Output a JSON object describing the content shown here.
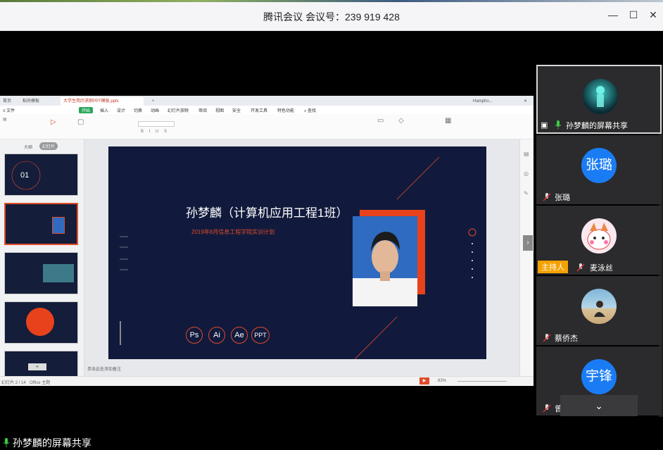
{
  "window": {
    "title": "腾讯会议  会议号：239 919 428"
  },
  "shared_screen": {
    "tabs": [
      "首页",
      "稻壳模板",
      "大学生简历求职PPT模板.pptx"
    ],
    "account": "Hampho...",
    "menus": [
      "开始",
      "插入",
      "设计",
      "切换",
      "动画",
      "幻灯片放映",
      "审阅",
      "视图",
      "安全",
      "开发工具",
      "特色功能",
      "查找"
    ],
    "active_menu": "开始",
    "thumbs_label": "大纲",
    "thumbs_tab": "幻灯片",
    "slide": {
      "title": "孙梦麟（计算机应用工程1班）",
      "subtitle": "2019年8月信息工程学院实训计划",
      "cover_num": "01",
      "software": [
        "Ps",
        "Ai",
        "Ae",
        "PPT"
      ]
    },
    "notes_hint": "单击此处添加备注",
    "status": {
      "slide_counter": "幻灯片 2 / 14",
      "theme": "Office 主题",
      "zoom": "83%"
    }
  },
  "participants": [
    {
      "name": "孙梦麟的屏幕共享",
      "avatar": "robot-avatar",
      "selected": true,
      "sharing": true
    },
    {
      "name": "张璐",
      "avatar_text": "张璐",
      "avatar_color": "#1a7cf5"
    },
    {
      "name": "麦泳丝",
      "avatar": "cartoon-avatar",
      "host": true,
      "host_label": "主持人"
    },
    {
      "name": "蔡侨杰",
      "avatar": "beach-photo-avatar"
    },
    {
      "name": "曾宇锋",
      "avatar_text": "宇锋",
      "avatar_color": "#1a7cf5"
    }
  ],
  "share_label": "孙梦麟的屏幕共享",
  "colors": {
    "slide_bg": "#111a3c",
    "accent": "#e04a2a",
    "avatar_blue": "#1a7cf5",
    "host_badge": "#f4a100"
  }
}
